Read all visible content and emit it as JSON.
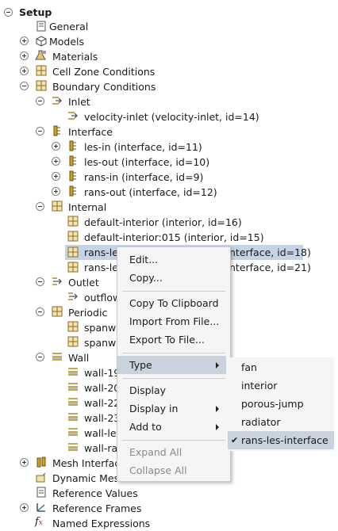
{
  "tree": {
    "setup": "Setup",
    "general": "General",
    "models": "Models",
    "materials": "Materials",
    "cell_zone": "Cell Zone Conditions",
    "boundary": "Boundary Conditions",
    "inlet": "Inlet",
    "velocity_inlet": "velocity-inlet (velocity-inlet, id=14)",
    "interface": "Interface",
    "les_in": "les-in (interface, id=11)",
    "les_out": "les-out (interface, id=10)",
    "rans_in": "rans-in (interface, id=9)",
    "rans_out": "rans-out (interface, id=12)",
    "internal": "Internal",
    "default_interior": "default-interior (interior, id=16)",
    "default_interior015": "default-interior:015 (interior, id=15)",
    "rans_les_18_a": "rans-le",
    "rans_les_18_b": "nterface, id=18)",
    "rans_les_21_a": "rans-le",
    "rans_les_21_b": "nterface, id=21)",
    "outlet": "Outlet",
    "outflow": "outflow",
    "periodic": "Periodic",
    "spanw1": "spanw",
    "spanw2": "spanw",
    "wall": "Wall",
    "wall1": "wall-19",
    "wall2": "wall-20",
    "wall3": "wall-22",
    "wall4": "wall-23",
    "wall5": "wall-le",
    "wall6": "wall-ra",
    "mesh_interfaces": "Mesh Interfac",
    "dynamic_mesh": "Dynamic Mes",
    "reference_values": "Reference Values",
    "reference_frames": "Reference Frames",
    "named_expressions": "Named Expressions"
  },
  "context_menu": {
    "edit": "Edit...",
    "copy": "Copy...",
    "copy_clipboard": "Copy To Clipboard",
    "import_file": "Import From File...",
    "export_file": "Export To File...",
    "type": "Type",
    "display": "Display",
    "display_in": "Display in",
    "add_to": "Add to",
    "expand_all": "Expand All",
    "collapse_all": "Collapse All"
  },
  "type_submenu": {
    "items": [
      "fan",
      "interior",
      "porous-jump",
      "radiator",
      "rans-les-interface"
    ],
    "checked": "rans-les-interface"
  }
}
